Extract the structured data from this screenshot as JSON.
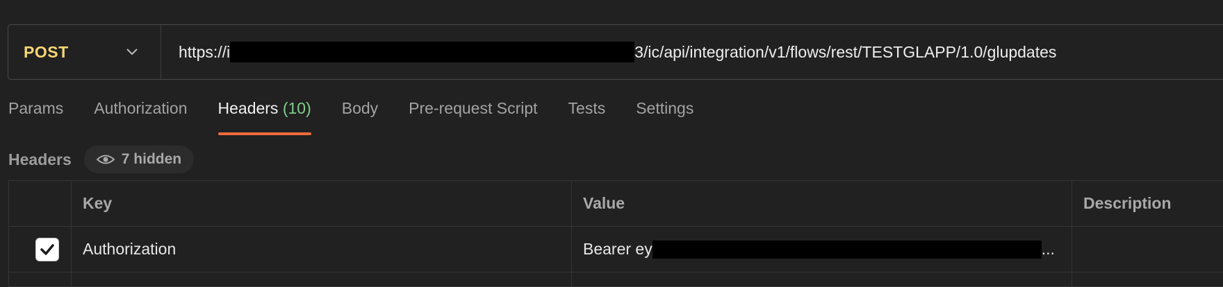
{
  "request": {
    "method": "POST",
    "url_prefix": "https://i",
    "url_suffix": "3/ic/api/integration/v1/flows/rest/TESTGLAPP/1.0/glupdates"
  },
  "tabs": [
    {
      "label": "Params"
    },
    {
      "label": "Authorization"
    },
    {
      "label": "Headers",
      "count": "(10)",
      "active": true
    },
    {
      "label": "Body"
    },
    {
      "label": "Pre-request Script"
    },
    {
      "label": "Tests"
    },
    {
      "label": "Settings"
    }
  ],
  "headers_section": {
    "title": "Headers",
    "hidden_label": "7 hidden"
  },
  "table": {
    "columns": [
      "Key",
      "Value",
      "Description"
    ],
    "rows": [
      {
        "checked": true,
        "key": "Authorization",
        "value_prefix": "Bearer ey",
        "value_suffix": "...",
        "description": ""
      }
    ]
  },
  "colors": {
    "method": "#f7d774",
    "active_tab_underline": "#f26b3a",
    "count": "#7fcf8c",
    "background": "#212121"
  },
  "icons": [
    "chevron-down-icon",
    "eye-icon",
    "check-icon"
  ]
}
